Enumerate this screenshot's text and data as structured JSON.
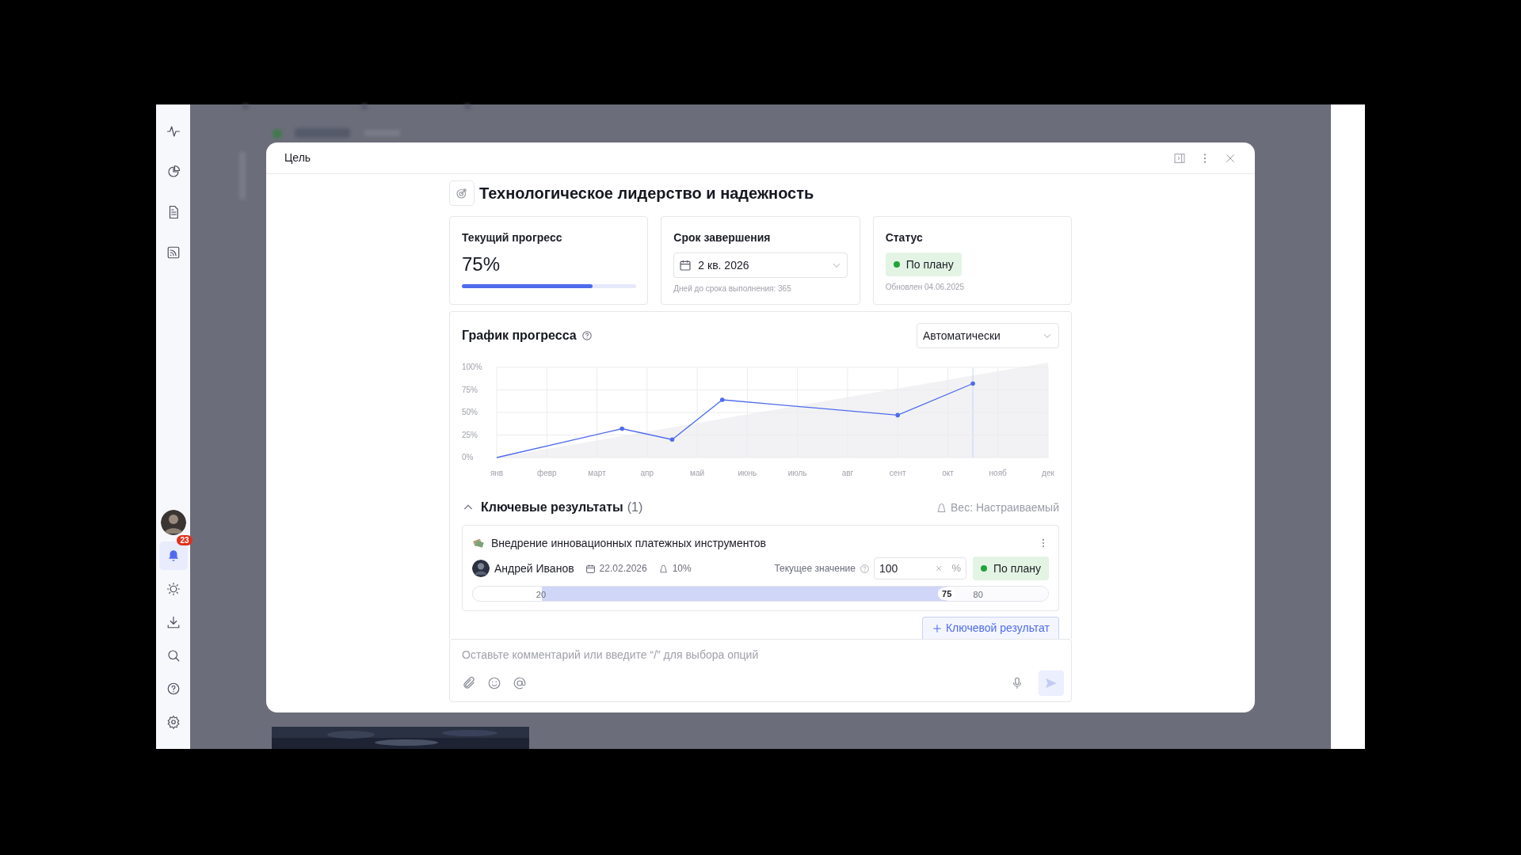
{
  "sidebar": {
    "items": [
      {
        "kind": "icon",
        "selected": false
      },
      {
        "kind": "icon",
        "selected": false
      },
      {
        "kind": "icon",
        "selected": false
      },
      {
        "kind": "icon",
        "selected": false
      }
    ],
    "bottom_items": [
      {
        "kind": "avatar",
        "selected": false
      },
      {
        "kind": "icon",
        "badge": "23",
        "selected": true
      },
      {
        "kind": "icon",
        "selected": false
      },
      {
        "kind": "icon",
        "selected": false
      },
      {
        "kind": "icon",
        "selected": false
      },
      {
        "kind": "icon",
        "selected": false
      },
      {
        "kind": "icon",
        "selected": false
      }
    ]
  },
  "modal": {
    "title": "Цель",
    "goal_title": "Технологическое лидерство и надежность",
    "progress_card": {
      "heading": "Текущий прогресс",
      "value": "75%",
      "level": 0.75
    },
    "deadline_card": {
      "heading": "Срок завершения",
      "value": "2 кв. 2026",
      "note": "Дней до срока выполнения: 365"
    },
    "status_card": {
      "heading": "Статус",
      "status": "По плану",
      "color": "#22a33a",
      "note": "Обновлен 04.06.2025"
    },
    "chart_section": {
      "title": "График прогресса",
      "mode": "Автоматически",
      "chart_data": {
        "type": "line",
        "categories": [
          "янв",
          null,
          "февр",
          null,
          "март",
          null,
          "апр",
          null,
          "май",
          null,
          "июнь",
          null,
          "июль",
          null,
          "авг",
          null,
          "сент",
          null,
          "окт",
          null,
          "нояб",
          null,
          "дек"
        ],
        "series": [
          {
            "color": "#4f6bed",
            "values": [
              0,
              null,
              null,
              null,
              null,
              32,
              null,
              20,
              null,
              64,
              null,
              null,
              null,
              null,
              null,
              null,
              47,
              null,
              null,
              82,
              null,
              null,
              null
            ]
          }
        ],
        "grid": true,
        "ylim": [
          0,
          100
        ],
        "yticks": [
          {
            "value": 0,
            "label": "0%"
          },
          {
            "value": 25,
            "label": "25%"
          },
          {
            "value": 50,
            "label": "50%"
          },
          {
            "value": 75,
            "label": "75%"
          },
          {
            "value": 100,
            "label": "100%"
          }
        ]
      }
    },
    "key_results": {
      "title": "Ключевые результаты",
      "count": "(1)",
      "expanded": true,
      "weight": "Вес: Настраиваемый",
      "items": [
        {
          "title": "Внедрение инновационных платежных инструментов",
          "owner": "Андрей Иванов",
          "date": "22.02.2026",
          "weight": "10%",
          "value_label": "Текущее значение",
          "value": "100",
          "unit": "%",
          "status": "По плану",
          "color": "#22a33a",
          "start": "20",
          "current": "75",
          "target": "80",
          "level": 0.8
        }
      ],
      "add_button": "Ключевой результат"
    },
    "comment": {
      "placeholder": "Оставьте комментарий или введите “/” для выбора опций"
    }
  }
}
